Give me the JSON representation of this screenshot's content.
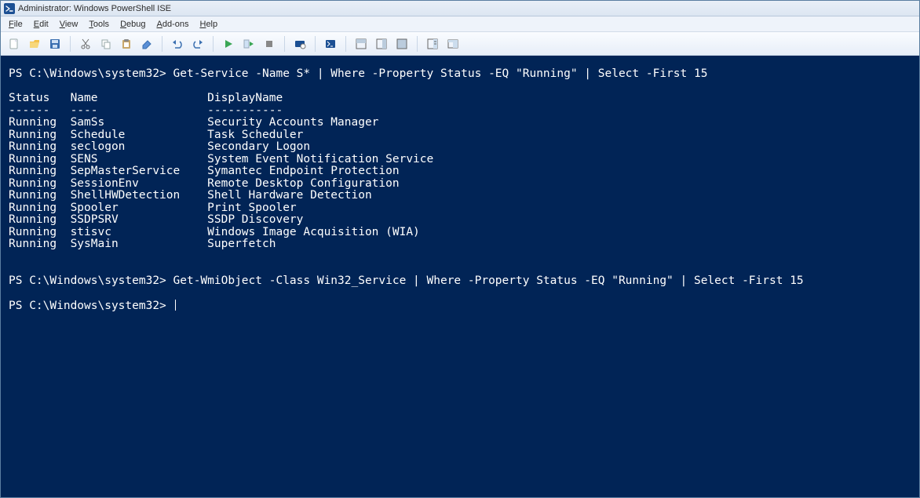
{
  "window": {
    "title": "Administrator: Windows PowerShell ISE"
  },
  "menubar": {
    "items": [
      {
        "label": "File",
        "accel": "F"
      },
      {
        "label": "Edit",
        "accel": "E"
      },
      {
        "label": "View",
        "accel": "V"
      },
      {
        "label": "Tools",
        "accel": "T"
      },
      {
        "label": "Debug",
        "accel": "D"
      },
      {
        "label": "Add-ons",
        "accel": "A"
      },
      {
        "label": "Help",
        "accel": "H"
      }
    ]
  },
  "toolbar": {
    "buttons": [
      "new-file",
      "open-file",
      "save-file",
      "cut",
      "copy",
      "paste",
      "clear",
      "undo",
      "redo",
      "run-script",
      "run-selection",
      "stop",
      "launch-powershell",
      "new-tab",
      "show-script-pane-top",
      "show-script-pane-right",
      "show-script-pane-max",
      "show-command-addon",
      "toggle-toolpane"
    ]
  },
  "colors": {
    "console_bg": "#012456",
    "console_fg": "#ffffff"
  },
  "console": {
    "prompt1": "PS C:\\Windows\\system32>",
    "command1": "Get-Service -Name S* | Where -Property Status -EQ \"Running\" | Select -First 15",
    "table": {
      "headers": [
        "Status",
        "Name",
        "DisplayName"
      ],
      "underlines": [
        "------",
        "----",
        "-----------"
      ],
      "rows": [
        [
          "Running",
          "SamSs",
          "Security Accounts Manager"
        ],
        [
          "Running",
          "Schedule",
          "Task Scheduler"
        ],
        [
          "Running",
          "seclogon",
          "Secondary Logon"
        ],
        [
          "Running",
          "SENS",
          "System Event Notification Service"
        ],
        [
          "Running",
          "SepMasterService",
          "Symantec Endpoint Protection"
        ],
        [
          "Running",
          "SessionEnv",
          "Remote Desktop Configuration"
        ],
        [
          "Running",
          "ShellHWDetection",
          "Shell Hardware Detection"
        ],
        [
          "Running",
          "Spooler",
          "Print Spooler"
        ],
        [
          "Running",
          "SSDPSRV",
          "SSDP Discovery"
        ],
        [
          "Running",
          "stisvc",
          "Windows Image Acquisition (WIA)"
        ],
        [
          "Running",
          "SysMain",
          "Superfetch"
        ]
      ]
    },
    "prompt2": "PS C:\\Windows\\system32>",
    "command2": "Get-WmiObject -Class Win32_Service | Where -Property Status -EQ \"Running\" | Select -First 15",
    "prompt3": "PS C:\\Windows\\system32>"
  }
}
